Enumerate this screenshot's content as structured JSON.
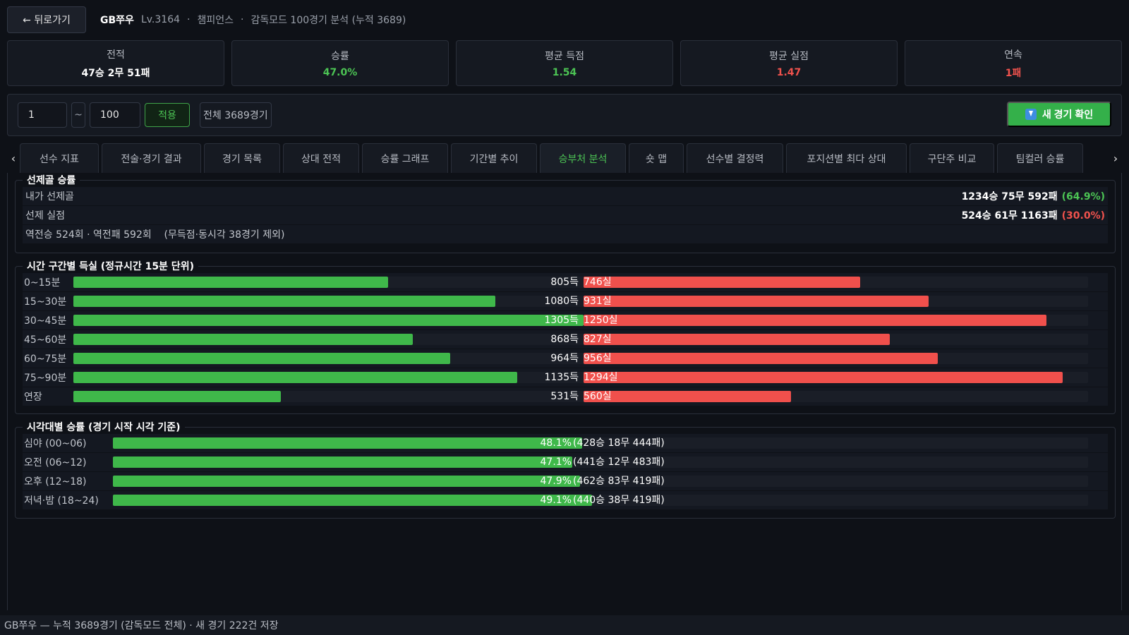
{
  "header": {
    "back_label": "← 뒤로가기",
    "player_name": "GB쭈우",
    "level": "Lv.3164",
    "sep": "·",
    "division": "챔피언스",
    "mode_info": "감독모드 100경기 분석 (누적 3689)"
  },
  "stats": [
    {
      "label": "전적",
      "value": "47승 2무 51패",
      "color": "white"
    },
    {
      "label": "승률",
      "value": "47.0%",
      "color": "green"
    },
    {
      "label": "평균 득점",
      "value": "1.54",
      "color": "green"
    },
    {
      "label": "평균 실점",
      "value": "1.47",
      "color": "red"
    },
    {
      "label": "연속",
      "value": "1패",
      "color": "red"
    }
  ],
  "filter": {
    "from_value": "1",
    "tilde": "~",
    "to_value": "100",
    "apply_label": "적용",
    "total_label": "전체 3689경기",
    "new_matches_label": "새 경기 확인"
  },
  "tabs": [
    "선수 지표",
    "전술·경기 결과",
    "경기 목록",
    "상대 전적",
    "승률 그래프",
    "기간별 추이",
    "승부처 분석",
    "숏 맵",
    "선수별 결정력",
    "포지션별 최다 상대",
    "구단주 비교",
    "팀컬러 승률"
  ],
  "active_tab": 6,
  "tab_prev_icon": "‹",
  "tab_next_icon": "›",
  "first_goal": {
    "title": "선제골 승률",
    "rows": [
      {
        "label": "내가 선제골",
        "value": "1234승 75무 592패",
        "pct": "(64.9%)",
        "color": "#4cc454"
      },
      {
        "label": "선제 실점",
        "value": "524승 61무 1163패",
        "pct": "(30.0%)",
        "color": "#f0524d"
      }
    ],
    "note": "역전승 524회 · 역전패 592회    (무득점·동시각 38경기 제외)"
  },
  "time_goals": {
    "title": "시간 구간별 득실 (정규시간 15분 단위)",
    "max": 1305,
    "rows": [
      {
        "label": "0~15분",
        "scored": 805,
        "conceded": 746,
        "scored_text": "805득",
        "conceded_text": "746실"
      },
      {
        "label": "15~30분",
        "scored": 1080,
        "conceded": 931,
        "scored_text": "1080득",
        "conceded_text": "931실"
      },
      {
        "label": "30~45분",
        "scored": 1305,
        "conceded": 1250,
        "scored_text": "1305득",
        "conceded_text": "1250실"
      },
      {
        "label": "45~60분",
        "scored": 868,
        "conceded": 827,
        "scored_text": "868득",
        "conceded_text": "827실"
      },
      {
        "label": "60~75분",
        "scored": 964,
        "conceded": 956,
        "scored_text": "964득",
        "conceded_text": "956실"
      },
      {
        "label": "75~90분",
        "scored": 1135,
        "conceded": 1294,
        "scored_text": "1135득",
        "conceded_text": "1294실"
      },
      {
        "label": "연장",
        "scored": 531,
        "conceded": 560,
        "scored_text": "531득",
        "conceded_text": "560실"
      }
    ]
  },
  "hour_winrate": {
    "title": "시각대별 승률 (경기 시작 시각 기준)",
    "rows": [
      {
        "label": "심야 (00~06)",
        "rate": 48.1,
        "rate_text": "48.1%",
        "record": "(428승 18무 444패)"
      },
      {
        "label": "오전 (06~12)",
        "rate": 47.1,
        "rate_text": "47.1%",
        "record": "(441승 12무 483패)"
      },
      {
        "label": "오후 (12~18)",
        "rate": 47.9,
        "rate_text": "47.9%",
        "record": "(462승 83무 419패)"
      },
      {
        "label": "저녁·밤 (18~24)",
        "rate": 49.1,
        "rate_text": "49.1%",
        "record": "(440승 38무 419패)"
      }
    ]
  },
  "colors": {
    "green": "#3fb84a",
    "red": "#f0504c"
  },
  "footer": "GB쭈우 — 누적 3689경기 (감독모드 전체) · 새 경기 222건 저장"
}
